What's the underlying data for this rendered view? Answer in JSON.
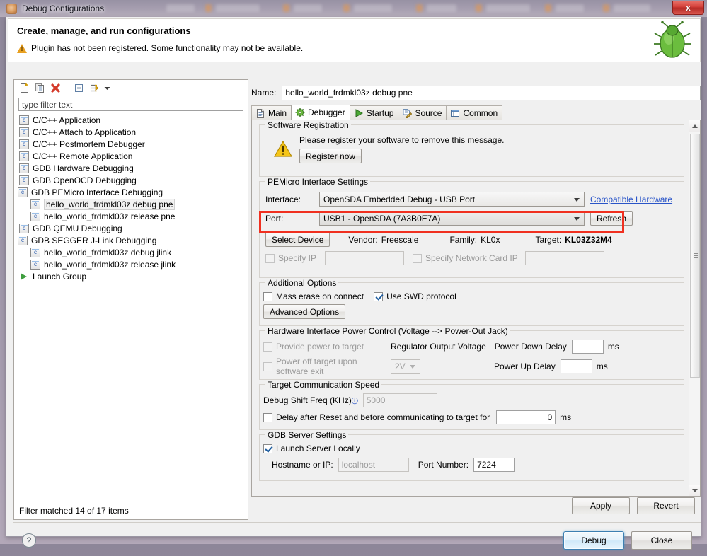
{
  "window": {
    "title": "Debug Configurations",
    "close_label": "x",
    "app_icon": "bug-app-icon"
  },
  "header": {
    "title": "Create, manage, and run configurations",
    "warning": "Plugin has not been registered. Some functionality may not be available.",
    "warning_icon": "warning-triangle-icon",
    "decor_icon": "green-bug-icon"
  },
  "left_panel": {
    "toolbar": [
      {
        "name": "new-configuration-icon",
        "glyph": "new"
      },
      {
        "name": "duplicate-configuration-icon",
        "glyph": "copy"
      },
      {
        "name": "delete-configuration-icon",
        "glyph": "delete"
      },
      {
        "name": "collapse-all-icon",
        "glyph": "collapse"
      },
      {
        "name": "filter-configurations-icon",
        "glyph": "filter"
      },
      {
        "name": "chevron-down-icon",
        "glyph": "chevron"
      }
    ],
    "filter": {
      "placeholder": "type filter text",
      "value": ""
    },
    "tree": [
      {
        "label": "C/C++ Application",
        "level": 0,
        "icon": "c-config-icon",
        "expander": "none",
        "selected": false
      },
      {
        "label": "C/C++ Attach to Application",
        "level": 0,
        "icon": "c-config-icon",
        "expander": "none",
        "selected": false
      },
      {
        "label": "C/C++ Postmortem Debugger",
        "level": 0,
        "icon": "c-config-icon",
        "expander": "none",
        "selected": false
      },
      {
        "label": "C/C++ Remote Application",
        "level": 0,
        "icon": "c-config-icon",
        "expander": "none",
        "selected": false
      },
      {
        "label": "GDB Hardware Debugging",
        "level": 0,
        "icon": "c-config-icon",
        "expander": "none",
        "selected": false
      },
      {
        "label": "GDB OpenOCD Debugging",
        "level": 0,
        "icon": "c-config-icon",
        "expander": "none",
        "selected": false
      },
      {
        "label": "GDB PEMicro Interface Debugging",
        "level": 0,
        "icon": "c-config-icon",
        "expander": "expanded",
        "selected": false
      },
      {
        "label": "hello_world_frdmkl03z debug pne",
        "level": 1,
        "icon": "c-config-icon",
        "expander": "none",
        "selected": true
      },
      {
        "label": "hello_world_frdmkl03z release pne",
        "level": 1,
        "icon": "c-config-icon",
        "expander": "none",
        "selected": false
      },
      {
        "label": "GDB QEMU Debugging",
        "level": 0,
        "icon": "c-config-icon",
        "expander": "none",
        "selected": false
      },
      {
        "label": "GDB SEGGER J-Link Debugging",
        "level": 0,
        "icon": "c-config-icon",
        "expander": "expanded",
        "selected": false
      },
      {
        "label": "hello_world_frdmkl03z debug jlink",
        "level": 1,
        "icon": "c-config-icon",
        "expander": "none",
        "selected": false
      },
      {
        "label": "hello_world_frdmkl03z release jlink",
        "level": 1,
        "icon": "c-config-icon",
        "expander": "none",
        "selected": false
      },
      {
        "label": "Launch Group",
        "level": 0,
        "icon": "launch-group-icon",
        "expander": "none",
        "selected": false
      }
    ],
    "status": "Filter matched 14 of 17 items"
  },
  "right_panel": {
    "name_label": "Name:",
    "name_value": "hello_world_frdmkl03z debug pne",
    "tabs": [
      {
        "label": "Main",
        "icon": "document-icon",
        "active": false
      },
      {
        "label": "Debugger",
        "icon": "gear-icon",
        "active": true
      },
      {
        "label": "Startup",
        "icon": "play-icon",
        "active": false
      },
      {
        "label": "Source",
        "icon": "source-edit-icon",
        "active": false
      },
      {
        "label": "Common",
        "icon": "table-icon",
        "active": false
      }
    ],
    "software_registration": {
      "title": "Software Registration",
      "message": "Please register your software to remove this message.",
      "button": "Register now",
      "icon": "warning-triangle-icon"
    },
    "pemicro": {
      "title": "PEMicro Interface Settings",
      "interface_label": "Interface:",
      "interface_value": "OpenSDA Embedded Debug - USB Port",
      "compatible_hardware_link": "Compatible Hardware",
      "port_label": "Port:",
      "port_value": "USB1 - OpenSDA (7A3B0E7A)",
      "refresh_button": "Refresh",
      "highlight_color": "#f03020",
      "select_device_button": "Select Device",
      "vendor_label": "Vendor:",
      "vendor_value": "Freescale",
      "family_label": "Family:",
      "family_value": "KL0x",
      "target_label": "Target:",
      "target_value": "KL03Z32M4",
      "specify_ip_label": "Specify IP",
      "specify_ip_checked": false,
      "specify_ip_value": "",
      "specify_network_card_ip_label": "Specify Network Card IP",
      "specify_network_card_ip_checked": false,
      "specify_network_card_ip_value": ""
    },
    "additional_options": {
      "title": "Additional Options",
      "mass_erase_label": "Mass erase on connect",
      "mass_erase_checked": false,
      "use_swd_label": "Use SWD protocol",
      "use_swd_checked": true,
      "advanced_options_button": "Advanced Options"
    },
    "power_control": {
      "title": "Hardware Interface Power Control (Voltage --> Power-Out Jack)",
      "provide_power_label": "Provide power to target",
      "provide_power_checked": false,
      "power_off_label": "Power off target upon software exit",
      "power_off_checked": false,
      "regulator_label": "Regulator Output Voltage",
      "regulator_value": "2V",
      "power_down_delay_label": "Power Down Delay",
      "power_down_delay_value": "",
      "power_up_delay_label": "Power Up Delay",
      "power_up_delay_value": "",
      "ms_label": "ms"
    },
    "comm_speed": {
      "title": "Target Communication Speed",
      "shift_freq_label": "Debug Shift Freq (KHz)",
      "shift_freq_info_icon": "info-icon",
      "shift_freq_value": "5000",
      "delay_label": "Delay after Reset and before communicating to target for",
      "delay_checked": false,
      "delay_value": "0",
      "ms_label": "ms"
    },
    "gdb_server": {
      "title": "GDB Server Settings",
      "launch_locally_label": "Launch Server Locally",
      "launch_locally_checked": true,
      "hostname_label": "Hostname or IP:",
      "hostname_placeholder": "localhost",
      "hostname_value": "",
      "port_number_label": "Port Number:",
      "port_number_value": "7224"
    },
    "apply_button": "Apply",
    "revert_button": "Revert"
  },
  "bottom": {
    "help_icon": "help-icon",
    "help_glyph": "?",
    "debug_button": "Debug",
    "close_button": "Close"
  }
}
